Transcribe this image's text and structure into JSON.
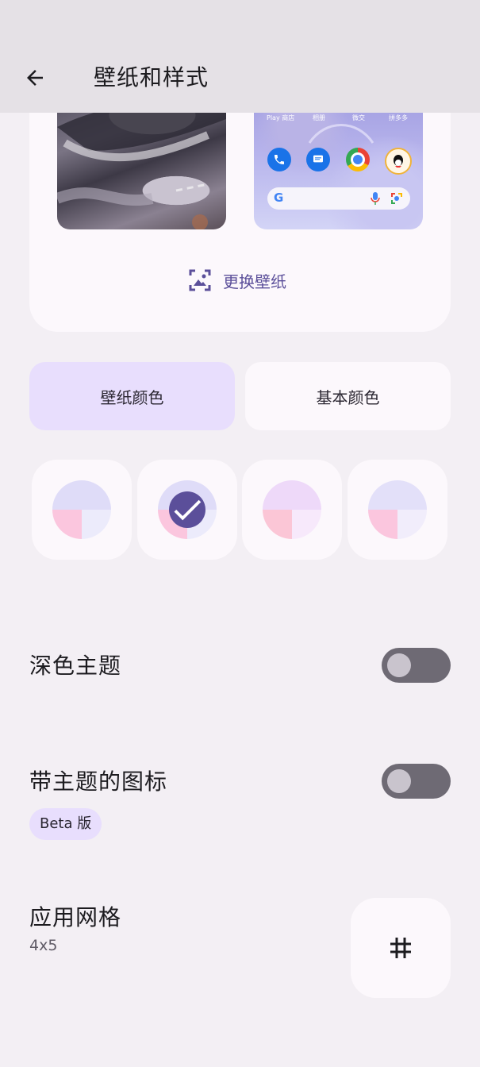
{
  "header": {
    "title": "壁纸和样式"
  },
  "wallpaper": {
    "home_labels": [
      "Play 商店",
      "相册",
      "微交",
      "拼多多"
    ],
    "change_label": "更换壁纸"
  },
  "tabs": [
    {
      "label": "壁纸颜色",
      "selected": true
    },
    {
      "label": "基本颜色",
      "selected": false
    }
  ],
  "color_options": [
    {
      "top": "#dfdcf8",
      "bottom_left": "#fbc6de",
      "bottom_right": "#ecebfb",
      "selected": false
    },
    {
      "top": "#dfdcf8",
      "bottom_left": "#fbc6de",
      "bottom_right": "#ecebfb",
      "selected": true
    },
    {
      "top": "#eed9f9",
      "bottom_left": "#fbc6d6",
      "bottom_right": "#f7e9fb",
      "selected": false
    },
    {
      "top": "#e3e0f9",
      "bottom_left": "#fbc6de",
      "bottom_right": "#f1edfb",
      "selected": false
    }
  ],
  "settings": {
    "dark_theme": {
      "label": "深色主题",
      "enabled": false
    },
    "themed_icons": {
      "label": "带主题的图标",
      "badge": "Beta 版",
      "enabled": false
    },
    "app_grid": {
      "label": "应用网格",
      "value": "4x5"
    }
  },
  "colors": {
    "accent": "#5b4f9a",
    "surface": "#fcf8fc",
    "background": "#f3eff4",
    "selected_tab": "#e8defd"
  }
}
